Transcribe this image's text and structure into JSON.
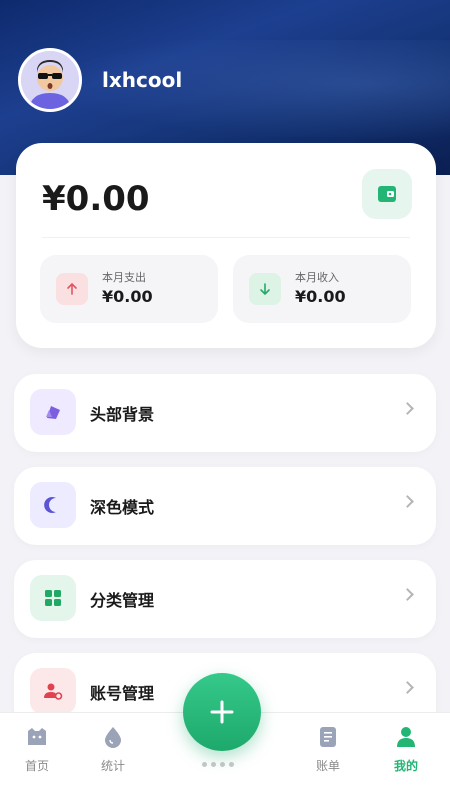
{
  "profile": {
    "username": "lxhcool"
  },
  "balance_card": {
    "balance": "¥0.00",
    "expense": {
      "label": "本月支出",
      "value": "¥0.00"
    },
    "income": {
      "label": "本月收入",
      "value": "¥0.00"
    }
  },
  "menu": [
    {
      "label": "头部背景",
      "icon": "image-icon",
      "color": "#7b5fe0",
      "bg": "#efeaff"
    },
    {
      "label": "深色模式",
      "icon": "moon-icon",
      "color": "#5b55d6",
      "bg": "#ecebff"
    },
    {
      "label": "分类管理",
      "icon": "grid-icon",
      "color": "#22a866",
      "bg": "#e4f6ec"
    },
    {
      "label": "账号管理",
      "icon": "user-settings-icon",
      "color": "#e0434f",
      "bg": "#fde8e9"
    }
  ],
  "tabbar": {
    "tabs": [
      {
        "label": "首页",
        "icon": "home-icon"
      },
      {
        "label": "统计",
        "icon": "chart-icon"
      },
      {
        "label": "账单",
        "icon": "bill-icon"
      },
      {
        "label": "我的",
        "icon": "user-icon",
        "active": true
      }
    ],
    "accent": "#22b573"
  }
}
